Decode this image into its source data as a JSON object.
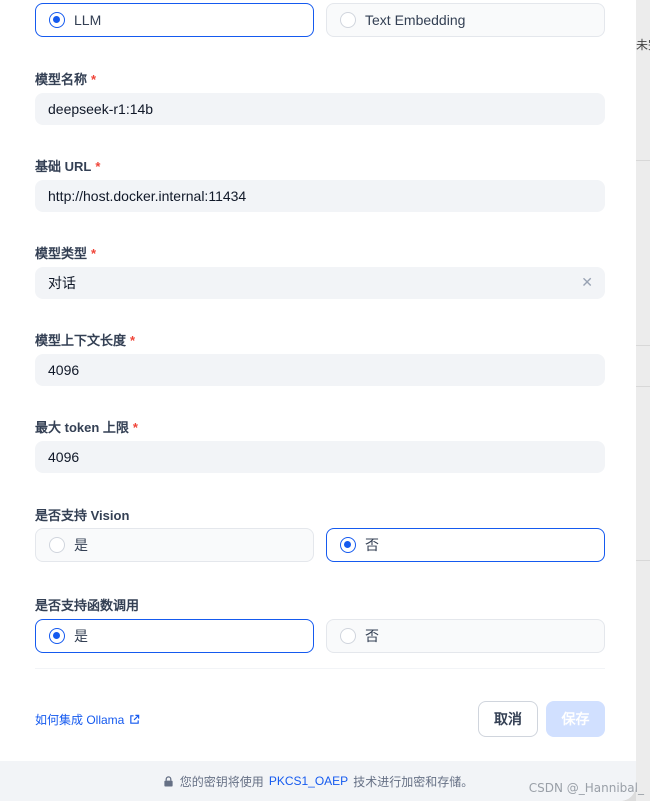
{
  "model_type_options": {
    "llm": "LLM",
    "text_embedding": "Text Embedding"
  },
  "fields": {
    "model_name": {
      "label": "模型名称",
      "value": "deepseek-r1:14b"
    },
    "base_url": {
      "label": "基础 URL",
      "value": "http://host.docker.internal:11434"
    },
    "model_kind": {
      "label": "模型类型",
      "value": "对话"
    },
    "context_length": {
      "label": "模型上下文长度",
      "value": "4096"
    },
    "max_tokens": {
      "label": "最大 token 上限",
      "value": "4096"
    }
  },
  "required_mark": "*",
  "vision": {
    "label": "是否支持 Vision",
    "yes": "是",
    "no": "否",
    "selected": "no"
  },
  "function_call": {
    "label": "是否支持函数调用",
    "yes": "是",
    "no": "否",
    "selected": "yes"
  },
  "help_link": "如何集成 Ollama",
  "buttons": {
    "cancel": "取消",
    "save": "保存"
  },
  "footer": {
    "before": "您的密钥将使用",
    "highlight": "PKCS1_OAEP",
    "after": "技术进行加密和存储。"
  },
  "background_peek_text": "未完",
  "watermark": "CSDN @_Hannibal_",
  "colors": {
    "accent": "#155aef",
    "required": "#f04438",
    "save_disabled": "#d1e0ff"
  }
}
